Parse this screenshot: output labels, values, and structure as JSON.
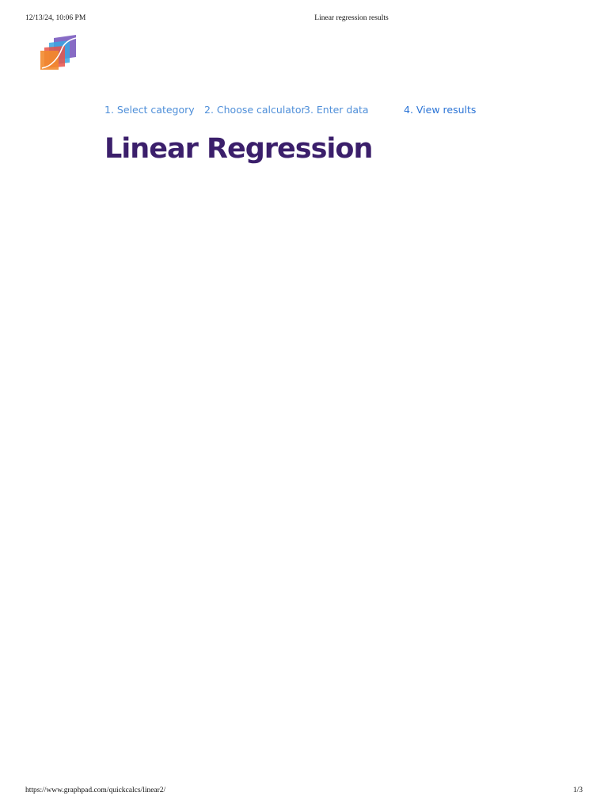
{
  "print_header": {
    "datetime": "12/13/24, 10:06 PM",
    "doc_title": "Linear regression results"
  },
  "print_footer": {
    "url": "https://www.graphpad.com/quickcalcs/linear2/",
    "page": "1/3"
  },
  "logo": {
    "icon": "graphpad-logo-icon",
    "colors": [
      "#f28a2e",
      "#e8524a",
      "#3aa6e0",
      "#7a5bbf"
    ]
  },
  "steps": [
    {
      "label": "1. Select category",
      "active": false
    },
    {
      "label": "2. Choose calculator",
      "active": false
    },
    {
      "label": "3. Enter data",
      "active": false
    },
    {
      "label": "4. View results",
      "active": true
    }
  ],
  "page_title": "Linear Regression",
  "colors": {
    "title": "#3b1f6b",
    "step_link": "#4f8fd9",
    "step_active": "#2b74d6"
  }
}
